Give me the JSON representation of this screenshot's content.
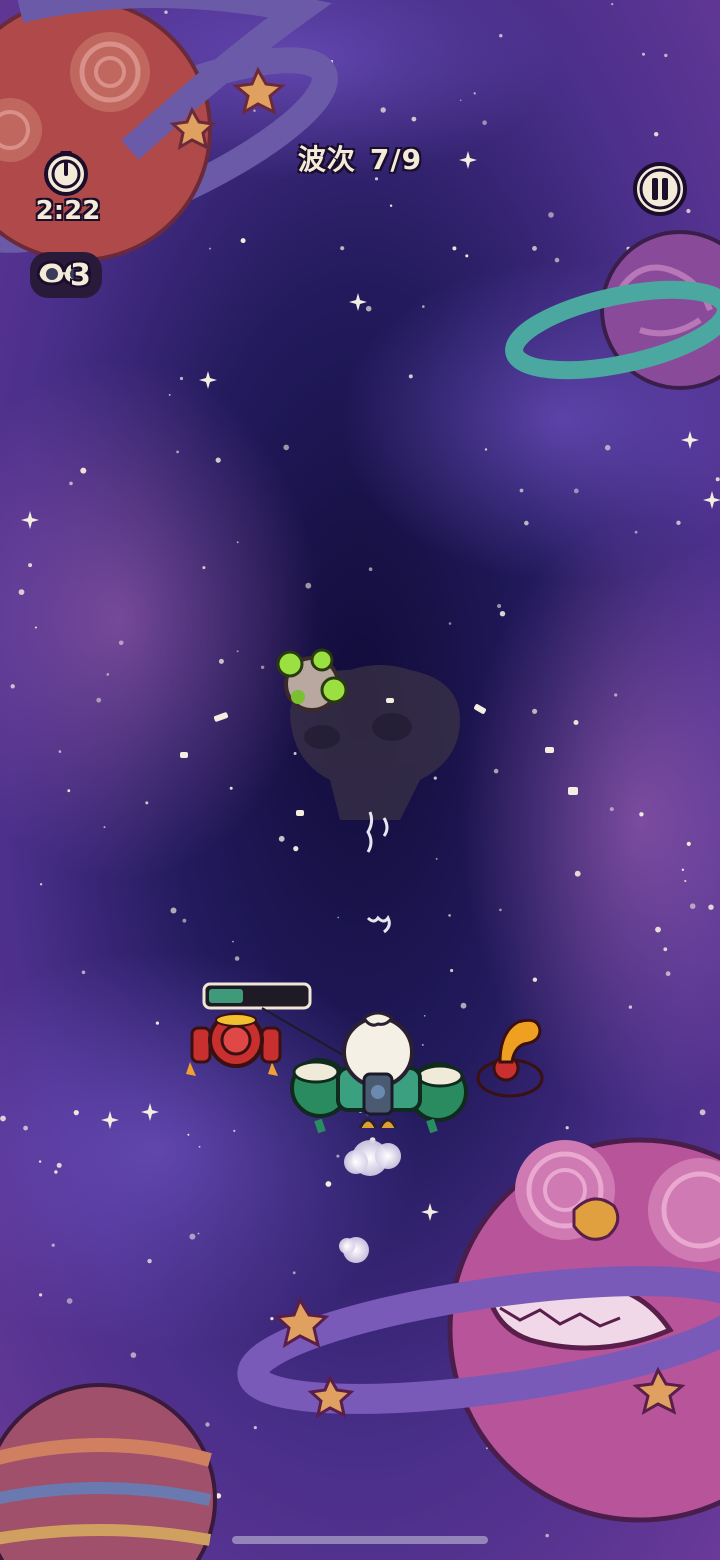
{
  "hud": {
    "wave_label": "波次",
    "wave_value": "7/9",
    "timer": "2:22",
    "lives": "3"
  },
  "icons": {
    "timer": "speedometer-icon",
    "lives": "goggles-icon",
    "pause": "pause-icon"
  },
  "player": {
    "health_fraction": 0.35
  },
  "colors": {
    "space_dark": "#1a1240",
    "space_purple": "#5a3a9a",
    "health_fill": "#3f9a7a",
    "hud_text": "#f3ead8"
  }
}
